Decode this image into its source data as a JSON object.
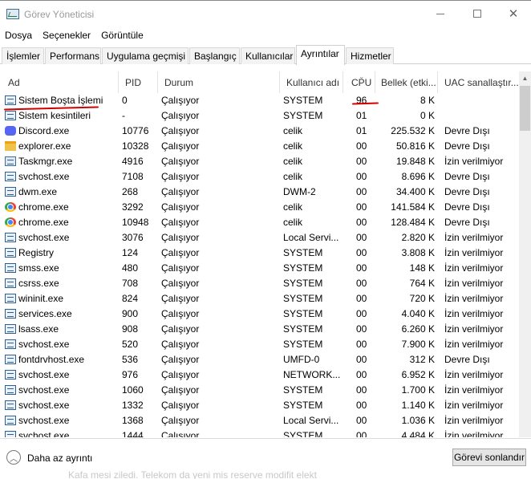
{
  "window": {
    "title": "Görev Yöneticisi"
  },
  "menu": [
    "Dosya",
    "Seçenekler",
    "Görüntüle"
  ],
  "tabs": [
    "İşlemler",
    "Performans",
    "Uygulama geçmişi",
    "Başlangıç",
    "Kullanıcılar",
    "Ayrıntılar",
    "Hizmetler"
  ],
  "active_tab": "Ayrıntılar",
  "columns": {
    "name": "Ad",
    "pid": "PID",
    "status": "Durum",
    "user": "Kullanıcı adı",
    "cpu": "CPU",
    "memory": "Bellek (etki...",
    "uac": "UAC sanallaştır..."
  },
  "rows": [
    {
      "icon": "window-process-icon",
      "name": "Sistem Boşta İşlemi",
      "pid": "0",
      "status": "Çalışıyor",
      "user": "SYSTEM",
      "cpu": "96",
      "memory": "8 K",
      "uac": ""
    },
    {
      "icon": "window-process-icon",
      "name": "Sistem kesintileri",
      "pid": "-",
      "status": "Çalışıyor",
      "user": "SYSTEM",
      "cpu": "01",
      "memory": "0 K",
      "uac": ""
    },
    {
      "icon": "discord-icon",
      "name": "Discord.exe",
      "pid": "10776",
      "status": "Çalışıyor",
      "user": "celik",
      "cpu": "01",
      "memory": "225.532 K",
      "uac": "Devre Dışı"
    },
    {
      "icon": "folder-icon",
      "name": "explorer.exe",
      "pid": "10328",
      "status": "Çalışıyor",
      "user": "celik",
      "cpu": "00",
      "memory": "50.816 K",
      "uac": "Devre Dışı"
    },
    {
      "icon": "taskmgr-icon",
      "name": "Taskmgr.exe",
      "pid": "4916",
      "status": "Çalışıyor",
      "user": "celik",
      "cpu": "00",
      "memory": "19.848 K",
      "uac": "İzin verilmiyor"
    },
    {
      "icon": "window-process-icon",
      "name": "svchost.exe",
      "pid": "7108",
      "status": "Çalışıyor",
      "user": "celik",
      "cpu": "00",
      "memory": "8.696 K",
      "uac": "Devre Dışı"
    },
    {
      "icon": "window-process-icon",
      "name": "dwm.exe",
      "pid": "268",
      "status": "Çalışıyor",
      "user": "DWM-2",
      "cpu": "00",
      "memory": "34.400 K",
      "uac": "Devre Dışı"
    },
    {
      "icon": "chrome-icon",
      "name": "chrome.exe",
      "pid": "3292",
      "status": "Çalışıyor",
      "user": "celik",
      "cpu": "00",
      "memory": "141.584 K",
      "uac": "Devre Dışı"
    },
    {
      "icon": "chrome-icon",
      "name": "chrome.exe",
      "pid": "10948",
      "status": "Çalışıyor",
      "user": "celik",
      "cpu": "00",
      "memory": "128.484 K",
      "uac": "Devre Dışı"
    },
    {
      "icon": "window-process-icon",
      "name": "svchost.exe",
      "pid": "3076",
      "status": "Çalışıyor",
      "user": "Local Servi...",
      "cpu": "00",
      "memory": "2.820 K",
      "uac": "İzin verilmiyor"
    },
    {
      "icon": "registry-icon",
      "name": "Registry",
      "pid": "124",
      "status": "Çalışıyor",
      "user": "SYSTEM",
      "cpu": "00",
      "memory": "3.808 K",
      "uac": "İzin verilmiyor"
    },
    {
      "icon": "window-process-icon",
      "name": "smss.exe",
      "pid": "480",
      "status": "Çalışıyor",
      "user": "SYSTEM",
      "cpu": "00",
      "memory": "148 K",
      "uac": "İzin verilmiyor"
    },
    {
      "icon": "window-process-icon",
      "name": "csrss.exe",
      "pid": "708",
      "status": "Çalışıyor",
      "user": "SYSTEM",
      "cpu": "00",
      "memory": "764 K",
      "uac": "İzin verilmiyor"
    },
    {
      "icon": "window-process-icon",
      "name": "wininit.exe",
      "pid": "824",
      "status": "Çalışıyor",
      "user": "SYSTEM",
      "cpu": "00",
      "memory": "720 K",
      "uac": "İzin verilmiyor"
    },
    {
      "icon": "window-process-icon",
      "name": "services.exe",
      "pid": "900",
      "status": "Çalışıyor",
      "user": "SYSTEM",
      "cpu": "00",
      "memory": "4.040 K",
      "uac": "İzin verilmiyor"
    },
    {
      "icon": "window-process-icon",
      "name": "lsass.exe",
      "pid": "908",
      "status": "Çalışıyor",
      "user": "SYSTEM",
      "cpu": "00",
      "memory": "6.260 K",
      "uac": "İzin verilmiyor"
    },
    {
      "icon": "window-process-icon",
      "name": "svchost.exe",
      "pid": "520",
      "status": "Çalışıyor",
      "user": "SYSTEM",
      "cpu": "00",
      "memory": "7.900 K",
      "uac": "İzin verilmiyor"
    },
    {
      "icon": "window-process-icon",
      "name": "fontdrvhost.exe",
      "pid": "536",
      "status": "Çalışıyor",
      "user": "UMFD-0",
      "cpu": "00",
      "memory": "312 K",
      "uac": "Devre Dışı"
    },
    {
      "icon": "window-process-icon",
      "name": "svchost.exe",
      "pid": "976",
      "status": "Çalışıyor",
      "user": "NETWORK...",
      "cpu": "00",
      "memory": "6.952 K",
      "uac": "İzin verilmiyor"
    },
    {
      "icon": "window-process-icon",
      "name": "svchost.exe",
      "pid": "1060",
      "status": "Çalışıyor",
      "user": "SYSTEM",
      "cpu": "00",
      "memory": "1.700 K",
      "uac": "İzin verilmiyor"
    },
    {
      "icon": "window-process-icon",
      "name": "svchost.exe",
      "pid": "1332",
      "status": "Çalışıyor",
      "user": "SYSTEM",
      "cpu": "00",
      "memory": "1.140 K",
      "uac": "İzin verilmiyor"
    },
    {
      "icon": "window-process-icon",
      "name": "svchost.exe",
      "pid": "1368",
      "status": "Çalışıyor",
      "user": "Local Servi...",
      "cpu": "00",
      "memory": "1.036 K",
      "uac": "İzin verilmiyor"
    },
    {
      "icon": "window-process-icon",
      "name": "svchost.exe",
      "pid": "1444",
      "status": "Çalışıyor",
      "user": "SYSTEM",
      "cpu": "00",
      "memory": "4.484 K",
      "uac": "İzin verilmiyor"
    }
  ],
  "footer": {
    "fewer_details": "Daha az ayrıntı",
    "end_task": "Görevi sonlandır",
    "bleed_text": "Kafa mesi ziledi. Telekom da yeni mis reserve modifit elekt"
  }
}
